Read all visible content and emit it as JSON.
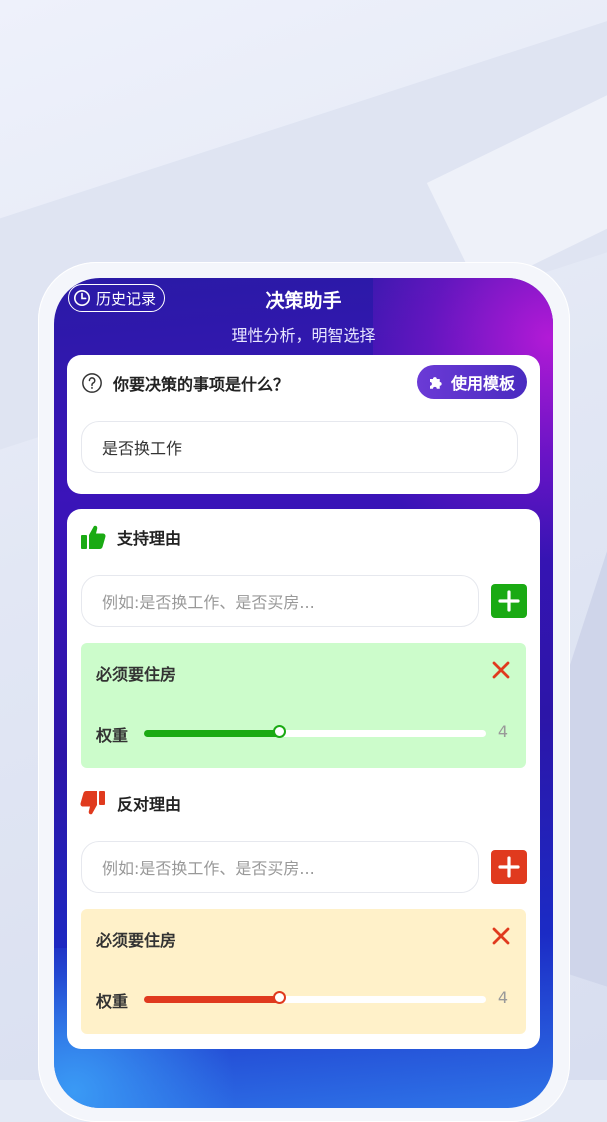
{
  "header": {
    "history_label": "历史记录",
    "title": "决策助手",
    "subtitle": "理性分析，明智选择"
  },
  "question": {
    "label": "你要决策的事项是什么？",
    "template_button": "使用模板",
    "value": "是否换工作"
  },
  "pros": {
    "title": "支持理由",
    "placeholder": "例如:是否换工作、是否买房...",
    "items": [
      {
        "label": "必须要住房",
        "weight_label": "权重",
        "weight": 4,
        "weight_max": 10
      }
    ]
  },
  "cons": {
    "title": "反对理由",
    "placeholder": "例如:是否换工作、是否买房...",
    "items": [
      {
        "label": "必须要住房",
        "weight_label": "权重",
        "weight": 4,
        "weight_max": 10
      }
    ]
  },
  "colors": {
    "pro": "#1aaa13",
    "con": "#e03a1e",
    "pro_bg": "#ccfccb",
    "con_bg": "#fff1c9",
    "accent": "#5a34cc"
  },
  "icons": {
    "history": "clock-icon",
    "question": "question-circle-icon",
    "template": "puzzle-icon",
    "pro": "thumbs-up-icon",
    "con": "thumbs-down-icon",
    "add": "plus-icon",
    "remove": "close-icon"
  }
}
